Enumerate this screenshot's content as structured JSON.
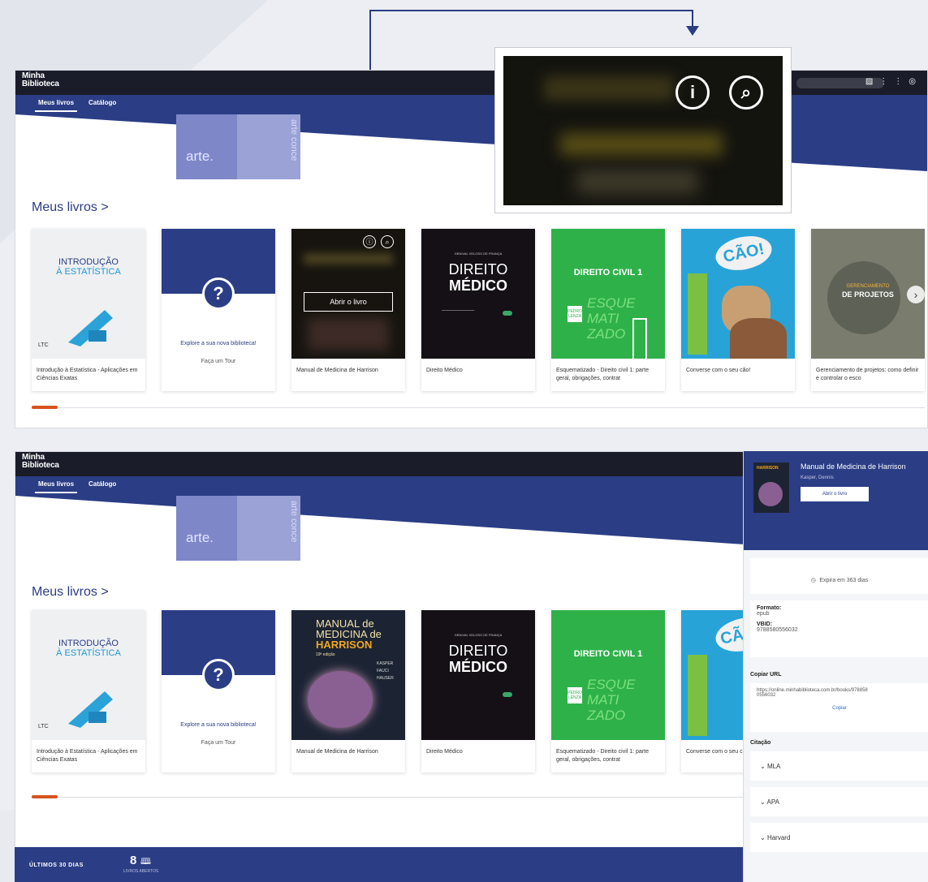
{
  "app": {
    "logo_line1": "Minha",
    "logo_line2": "Biblioteca"
  },
  "nav": {
    "tab_my_books": "Meus livros",
    "tab_catalog": "Catálogo"
  },
  "banner": {
    "text_a": "arte.",
    "text_b": "arte conce"
  },
  "section": {
    "title": "Meus livros >"
  },
  "books": [
    {
      "caption": "Introdução à Estatística - Aplicações em Ciências Exatas",
      "cover_lines": [
        "INTRODUÇÃO",
        "À ESTATÍSTICA"
      ],
      "cover_publisher": "LTC"
    },
    {
      "caption": "Explore a sua nova biblioteca!",
      "tour_label": "Faça um Tour",
      "qmark": "?"
    },
    {
      "caption": "Manual de Medicina de Harrison",
      "hover_button": "Abrir o livro",
      "cover_lines": [
        "MANUAL de",
        "MEDICINA de",
        "HARRISON",
        "19ª edição"
      ],
      "cover_authors": [
        "KASPER",
        "FAUCI",
        "HAUSER"
      ]
    },
    {
      "caption": "Direito Médico",
      "cover_lines": [
        "DIREITO",
        "MÉDICO"
      ],
      "cover_author": "GENIVAL VELOSO DE FRANÇA"
    },
    {
      "caption": "Esquematizado - Direito civil 1: parte geral, obrigações, contrat",
      "cover_lines": [
        "DIREITO CIVIL 1",
        "ESQUE",
        "MATI",
        "ZADO"
      ],
      "cover_author": "PEDRO LENZA"
    },
    {
      "caption": "Converse com o seu cão!",
      "cover_lines": [
        "CÃO!"
      ]
    },
    {
      "caption": "Gerenciamento de projetos: como definir e controlar o esco",
      "cover_lines": [
        "GERENCIAMENTO",
        "DE PROJETOS"
      ]
    }
  ],
  "panel": {
    "title": "Manual de Medicina de Harrison",
    "author": "Kasper, Dennis",
    "open_button": "Abrir o livro",
    "expires": "Expira em 363 dias",
    "format_label": "Formato:",
    "format_value": "epub",
    "vbid_label": "VBID:",
    "vbid_value": "9788580556032",
    "copy_url_label": "Copiar URL",
    "url_line1": "https://online.minhabiblioteca.com.br/books/978858",
    "url_line2": "0556032",
    "copy_button": "Copiar",
    "citation_label": "Citação",
    "citations": [
      "MLA",
      "APA",
      "Harvard"
    ]
  },
  "stats": {
    "label": "ÚLTIMOS 30 DIAS",
    "count": "8",
    "count_label": "LIVROS ABERTOS"
  },
  "colors": {
    "brand_blue": "#2b3d85",
    "appbar": "#1a1c29",
    "accent_orange": "#d8531c"
  }
}
